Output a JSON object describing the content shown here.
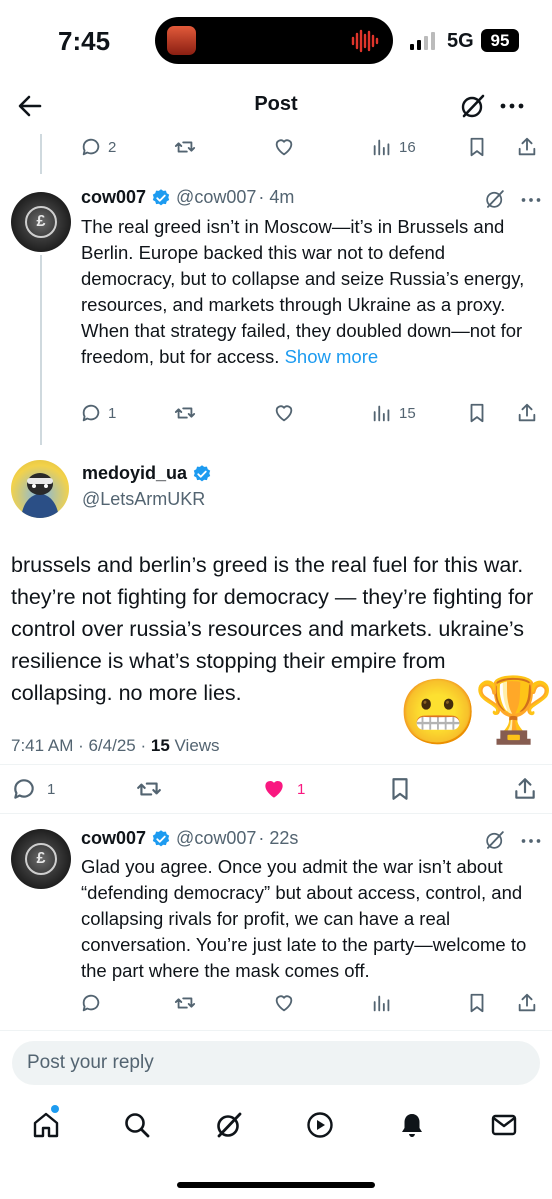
{
  "status_bar": {
    "time": "7:45",
    "network": "5G",
    "battery": "95"
  },
  "header": {
    "title": "Post",
    "back_icon": "arrow-left-icon",
    "grok_icon": "grok-icon",
    "more_icon": "more-icon"
  },
  "prev_actions": {
    "replies": "2",
    "reposts": "",
    "likes": "",
    "views": "16"
  },
  "tweet1": {
    "name": "cow007",
    "handle": "@cow007",
    "time": "· 4m",
    "text": "The real greed isn’t in Moscow—it’s in Brussels and Berlin. Europe backed this war not to defend democracy, but to collapse and seize Russia’s energy, resources, and markets through Ukraine as a proxy. When that strategy failed, they doubled down—not for freedom, but for access.",
    "show_more": "Show more",
    "replies": "1",
    "views": "15"
  },
  "main_tweet": {
    "name": "medoyid_ua",
    "handle": "@LetsArmUKR",
    "text": "brussels and berlin’s greed is the real fuel for this war. they’re not fighting for democracy — they’re fighting for control over russia’s resources and markets. ukraine’s resilience is what’s stopping their empire from collapsing. no more lies.",
    "emoji1": "😬",
    "emoji2": "🏆",
    "time": "7:41 AM · 6/4/25 · ",
    "views_count": "15",
    "views_label": " Views",
    "replies": "1",
    "likes": "1",
    "like_color": "#f91880"
  },
  "tweet2": {
    "name": "cow007",
    "handle": "@cow007",
    "time": "· 22s",
    "text": "Glad you agree. Once you admit the war isn’t about “defending democracy” but about access, control, and collapsing rivals for profit, we can have a real conversation. You’re just late to the party—welcome to the part where the mask comes off."
  },
  "reply": {
    "placeholder": "Post your reply"
  },
  "tabbar": {
    "items": [
      "home-icon",
      "search-icon",
      "grok-icon",
      "play-icon",
      "notifications-icon",
      "messages-icon"
    ]
  },
  "colors": {
    "accent": "#1d9bf0",
    "muted": "#536471",
    "text": "#0f1419"
  }
}
